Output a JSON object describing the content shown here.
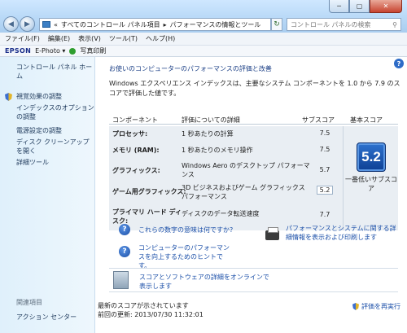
{
  "window": {
    "minimize": "─",
    "maximize": "▢",
    "close": "✕"
  },
  "address": {
    "back_icon": "◀",
    "forward_icon": "▶",
    "path_sep": "«",
    "crumb1": "すべてのコントロール パネル項目",
    "crumb_arrow": "▸",
    "crumb2": "パフォーマンスの情報とツール",
    "refresh_icon": "↻",
    "search_placeholder": "コントロール パネルの検索",
    "search_icon": "⚲"
  },
  "menu": [
    "ファイル(F)",
    "編集(E)",
    "表示(V)",
    "ツール(T)",
    "ヘルプ(H)"
  ],
  "epson": {
    "brand": "EPSON",
    "app": "E-Photo",
    "dropdown": "▾",
    "print": "写真印刷"
  },
  "sidebar": {
    "home": "コントロール パネル ホーム",
    "links": [
      {
        "label": "視覚効果の調整",
        "shield": true
      },
      {
        "label": "インデックスのオプションの調整",
        "shield": false
      },
      {
        "label": "電源設定の調整",
        "shield": false
      },
      {
        "label": "ディスク クリーンアップを開く",
        "shield": false
      },
      {
        "label": "詳細ツール",
        "shield": false
      }
    ],
    "see_also": "関連項目",
    "action_center": "アクション センター"
  },
  "main": {
    "help_icon": "?",
    "heading": "お使いのコンピューターのパフォーマンスの評価と改善",
    "intro": "Windows エクスペリエンス インデックスは、主要なシステム コンポーネントを 1.0 から 7.9 のスコアで評価した値です。",
    "columns": {
      "component": "コンポーネント",
      "detail": "評価についての詳細",
      "subscore": "サブスコア",
      "basescore": "基本スコア"
    },
    "rows": [
      {
        "component": "プロセッサ:",
        "detail": "1 秒あたりの計算",
        "score": "7.5"
      },
      {
        "component": "メモリ (RAM):",
        "detail": "1 秒あたりのメモリ操作",
        "score": "7.5"
      },
      {
        "component": "グラフィックス:",
        "detail": "Windows Aero のデスクトップ パフォーマンス",
        "score": "5.7"
      },
      {
        "component": "ゲーム用グラフィックス:",
        "detail": "3D ビジネスおよびゲーム グラフィックス パフォーマンス",
        "score": "5.2"
      },
      {
        "component": "プライマリ ハード ディスク:",
        "detail": "ディスクのデータ転送速度",
        "score": "7.7"
      }
    ],
    "base_score": "5.2",
    "base_caption": "一番低いサブスコア",
    "link_meaning": "これらの数字の意味は何ですか?",
    "link_improve": "コンピューターのパフォーマンスを向上するためのヒントです。",
    "link_print": "パフォーマンスとシステムに関する詳細情報を表示および印刷します",
    "link_online": "スコアとソフトウェアの詳細をオンラインで表示します",
    "status_line": "最新のスコアが示されています",
    "last_update": "前回の更新: 2013/07/30 11:32:01",
    "rescore": "評価を再実行"
  }
}
